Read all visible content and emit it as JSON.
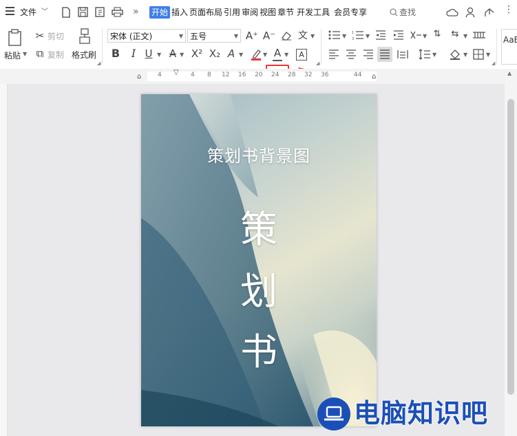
{
  "menubar": {
    "menu_label": "文件",
    "tabs": [
      {
        "label": "开始",
        "active": true
      },
      {
        "label": "插入"
      },
      {
        "label": "页面布局"
      },
      {
        "label": "引用"
      },
      {
        "label": "审阅"
      },
      {
        "label": "视图"
      },
      {
        "label": "章节"
      },
      {
        "label": "开发工具"
      },
      {
        "label": "会员专享"
      }
    ],
    "search_label": "查找",
    "more_glyph": "»"
  },
  "ribbon": {
    "paste_label": "粘贴",
    "cut_label": "剪切",
    "copy_label": "复制",
    "format_painter_label": "格式刷",
    "font_name": "宋体 (正文)",
    "font_size": "五号",
    "style_preview": "AaB",
    "bold": "B",
    "italic": "I",
    "underline": "U",
    "strikethrough": "A",
    "superscript": "X²",
    "subscript": "X₂",
    "font_color": "A",
    "highlight_label": "A",
    "char_border": "A",
    "grow_font": "A⁺",
    "shrink_font": "A⁻",
    "pinyin": "文"
  },
  "ruler": {
    "ticks": [
      "4",
      "4",
      "8",
      "12",
      "16",
      "20",
      "24",
      "28",
      "32",
      "36",
      "44"
    ]
  },
  "document": {
    "subtitle": "策划书背景图",
    "title_chars": [
      "策",
      "划",
      "书"
    ]
  },
  "watermark": {
    "text": "电脑知识吧"
  },
  "colors": {
    "accent": "#3f7fe8",
    "highlight_box": "#e53935",
    "font_color_bar": "#e53935"
  }
}
